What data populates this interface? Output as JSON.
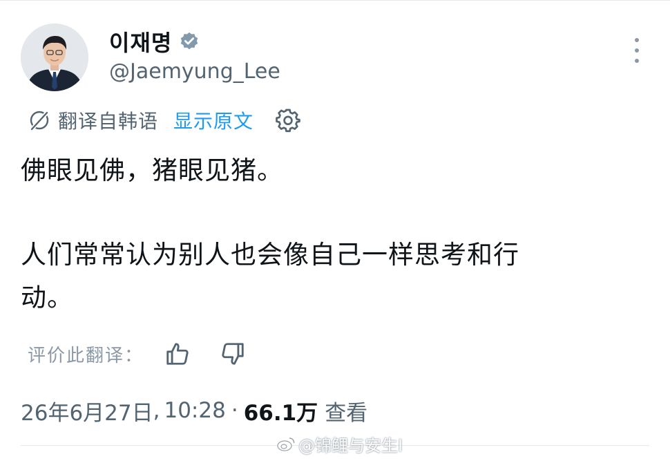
{
  "user": {
    "display_name": "이재명",
    "handle": "@Jaemyung_Lee",
    "verified": true
  },
  "translation_bar": {
    "label": "翻译自韩语",
    "show_original": "显示原文"
  },
  "tweet": {
    "line1": "佛眼见佛，猪眼见猪。",
    "line2": "人们常常认为别人也会像自己一样思考和行",
    "line3": "动。"
  },
  "rate": {
    "label": "评价此翻译："
  },
  "meta": {
    "date": "26年6月27日",
    "time": "10:28",
    "separator": "·",
    "views_count": "66.1万",
    "views_label": "查看"
  },
  "watermark": {
    "text": "@锦鲤与安生I"
  },
  "colors": {
    "link": "#1d9bf0",
    "secondary_text": "#536471",
    "primary_text": "#0f1419"
  },
  "icons": [
    "verified-badge-icon",
    "more-icon",
    "translate-icon",
    "gear-icon",
    "thumbs-up-icon",
    "thumbs-down-icon",
    "weibo-icon"
  ]
}
